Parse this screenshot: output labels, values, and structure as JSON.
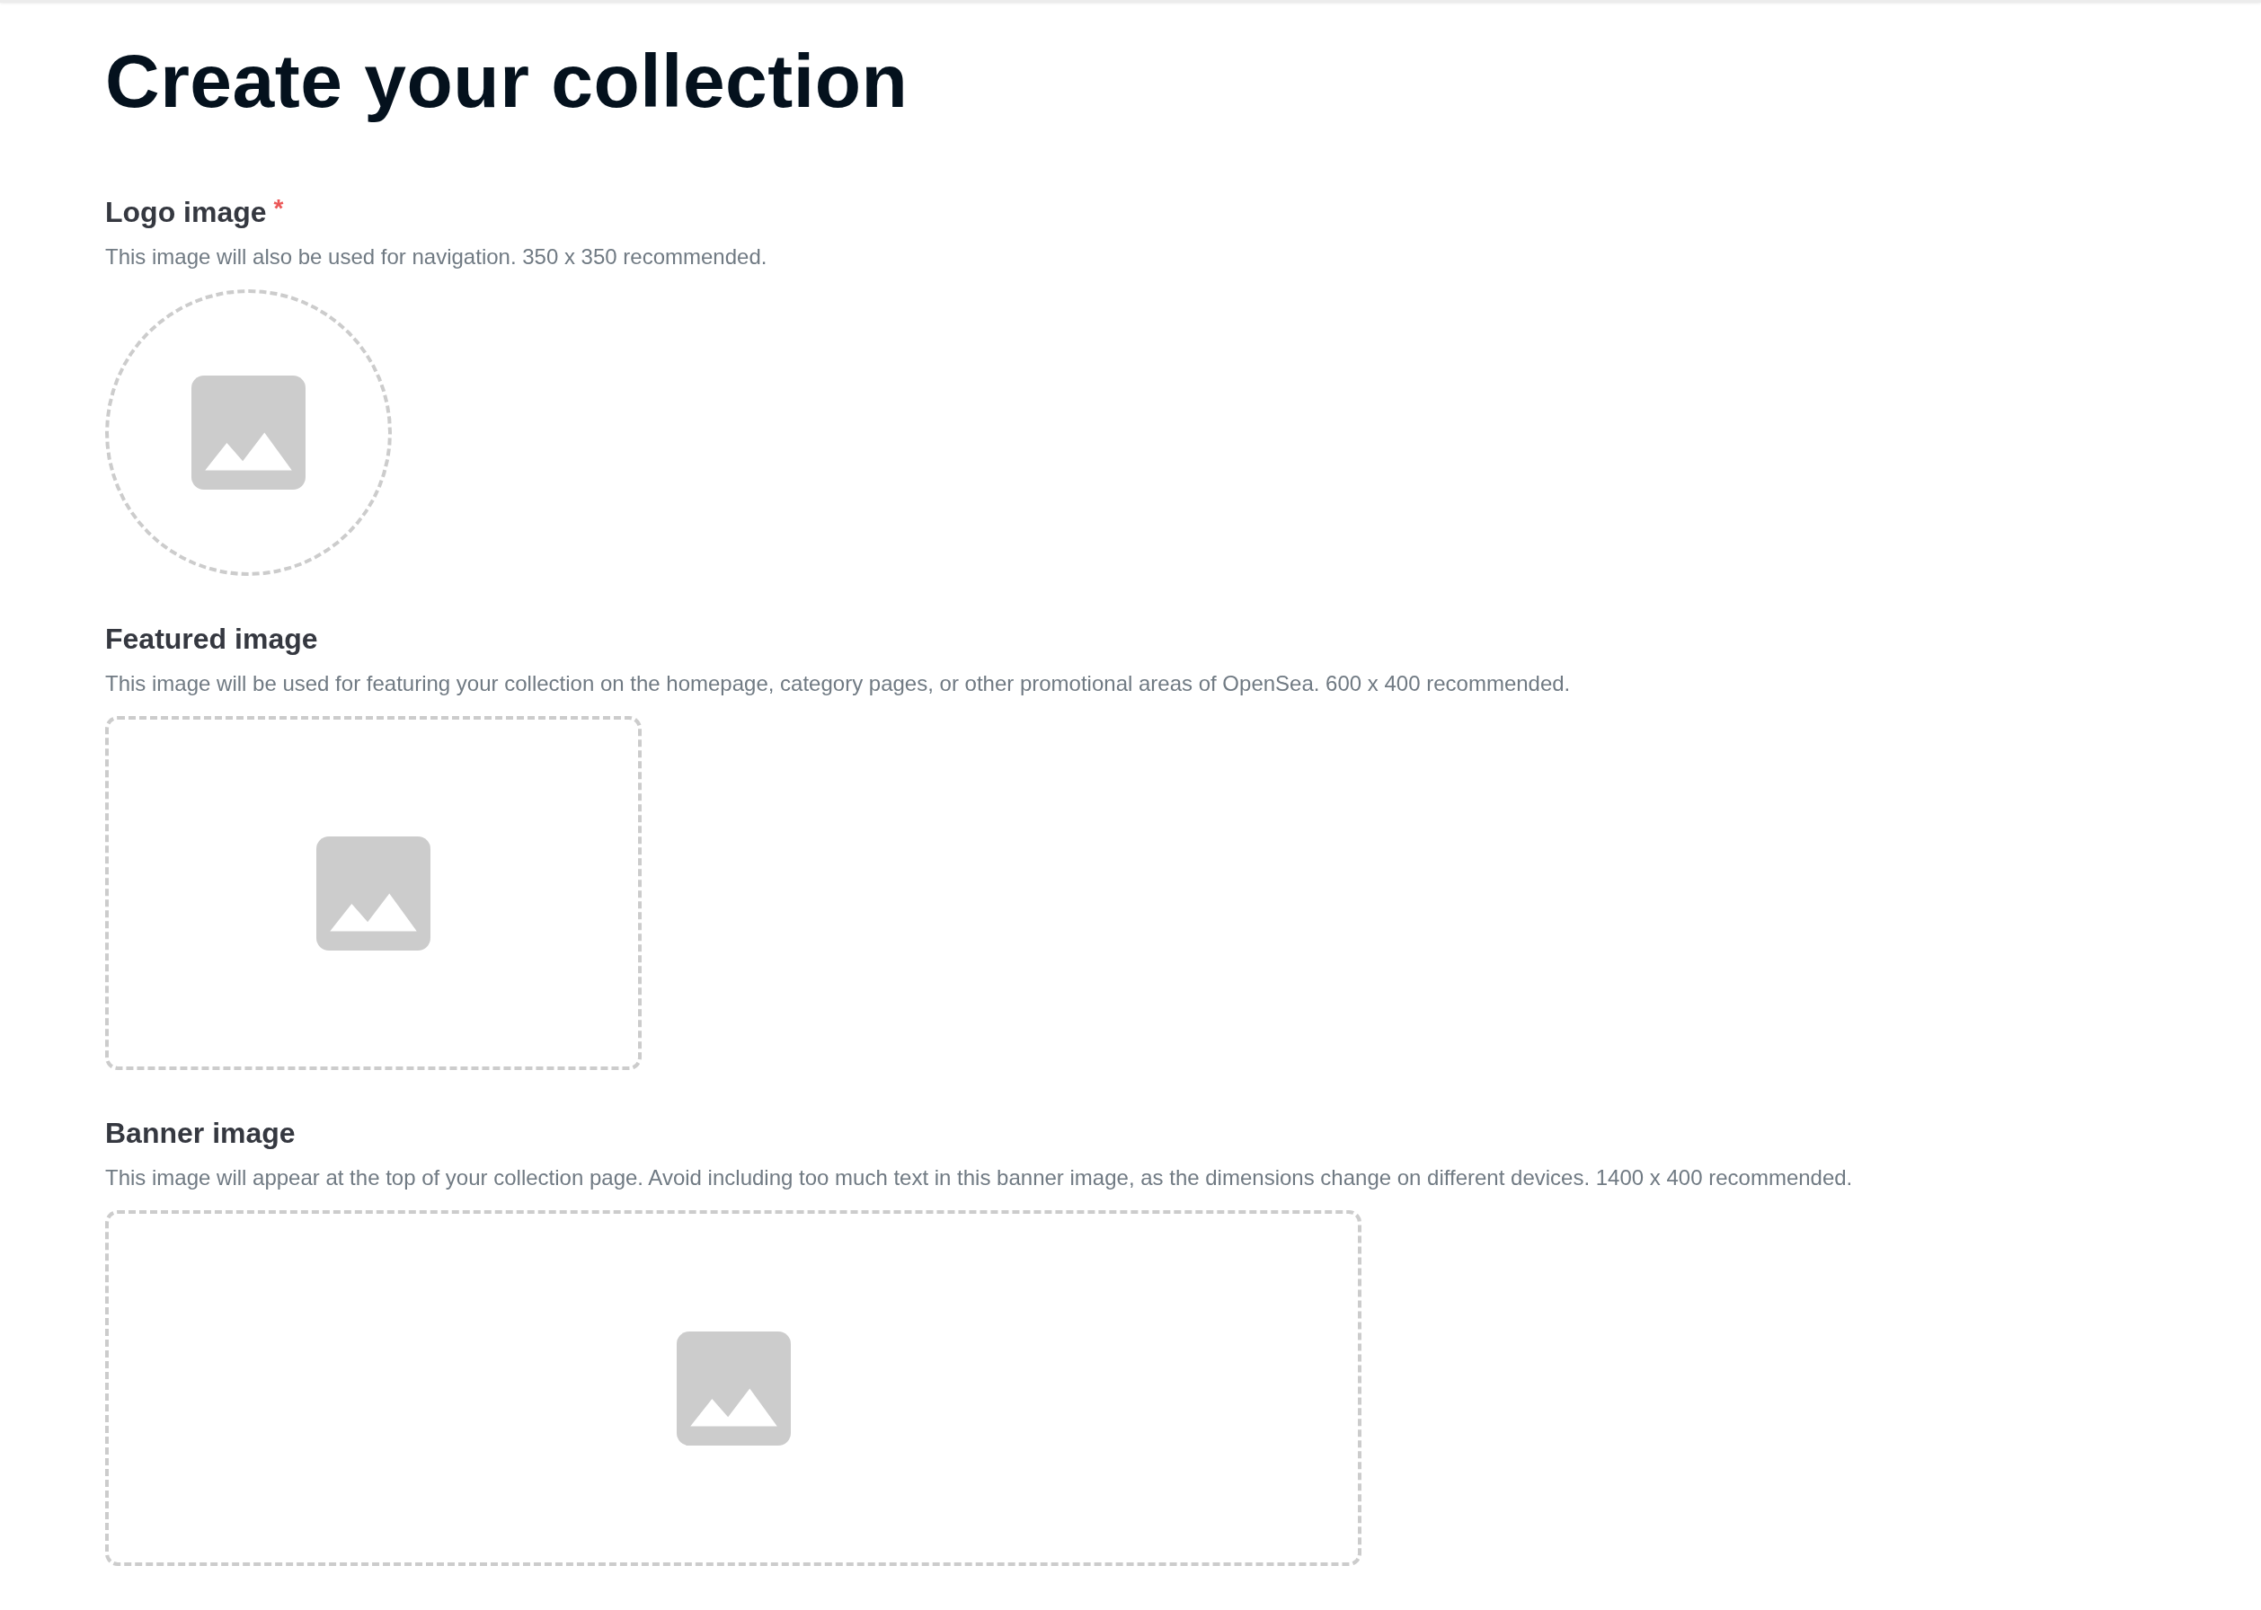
{
  "page": {
    "title": "Create your collection"
  },
  "fields": [
    {
      "kind": "logo",
      "label": "Logo image",
      "required_mark": "*",
      "description": "This image will also be used for navigation. 350 x 350 recommended."
    },
    {
      "kind": "featured",
      "label": "Featured image",
      "description": "This image will be used for featuring your collection on the homepage, category pages, or other promotional areas of OpenSea. 600 x 400 recommended."
    },
    {
      "kind": "banner",
      "label": "Banner image",
      "description": "This image will appear at the top of your collection page. Avoid including too much text in this banner image, as the dimensions change on different devices. 1400 x 400 recommended."
    }
  ]
}
